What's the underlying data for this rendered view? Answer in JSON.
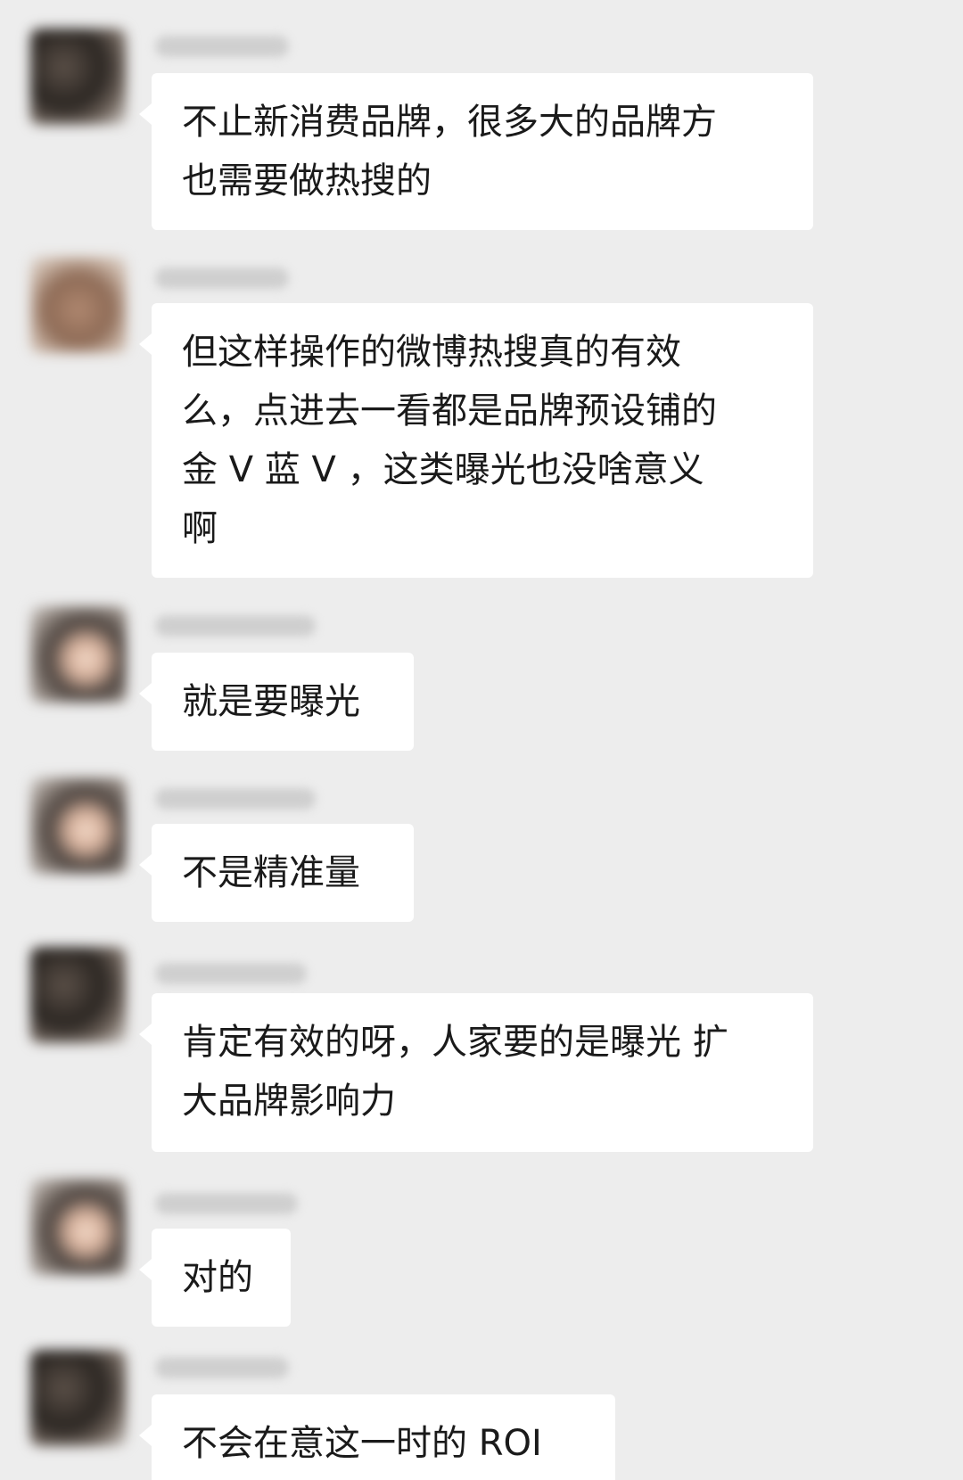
{
  "messages": [
    {
      "text": "不止新消费品牌，很多大的品牌方\n也需要做热搜的"
    },
    {
      "text": "但这样操作的微博热搜真的有效\n么，点进去一看都是品牌预设铺的\n金 V 蓝 V ，这类曝光也没啥意义\n啊"
    },
    {
      "text": "就是要曝光"
    },
    {
      "text": "不是精准量"
    },
    {
      "text": "肯定有效的呀，人家要的是曝光 扩\n大品牌影响力"
    },
    {
      "text": "对的"
    },
    {
      "text": "不会在意这一时的 ROI"
    }
  ]
}
